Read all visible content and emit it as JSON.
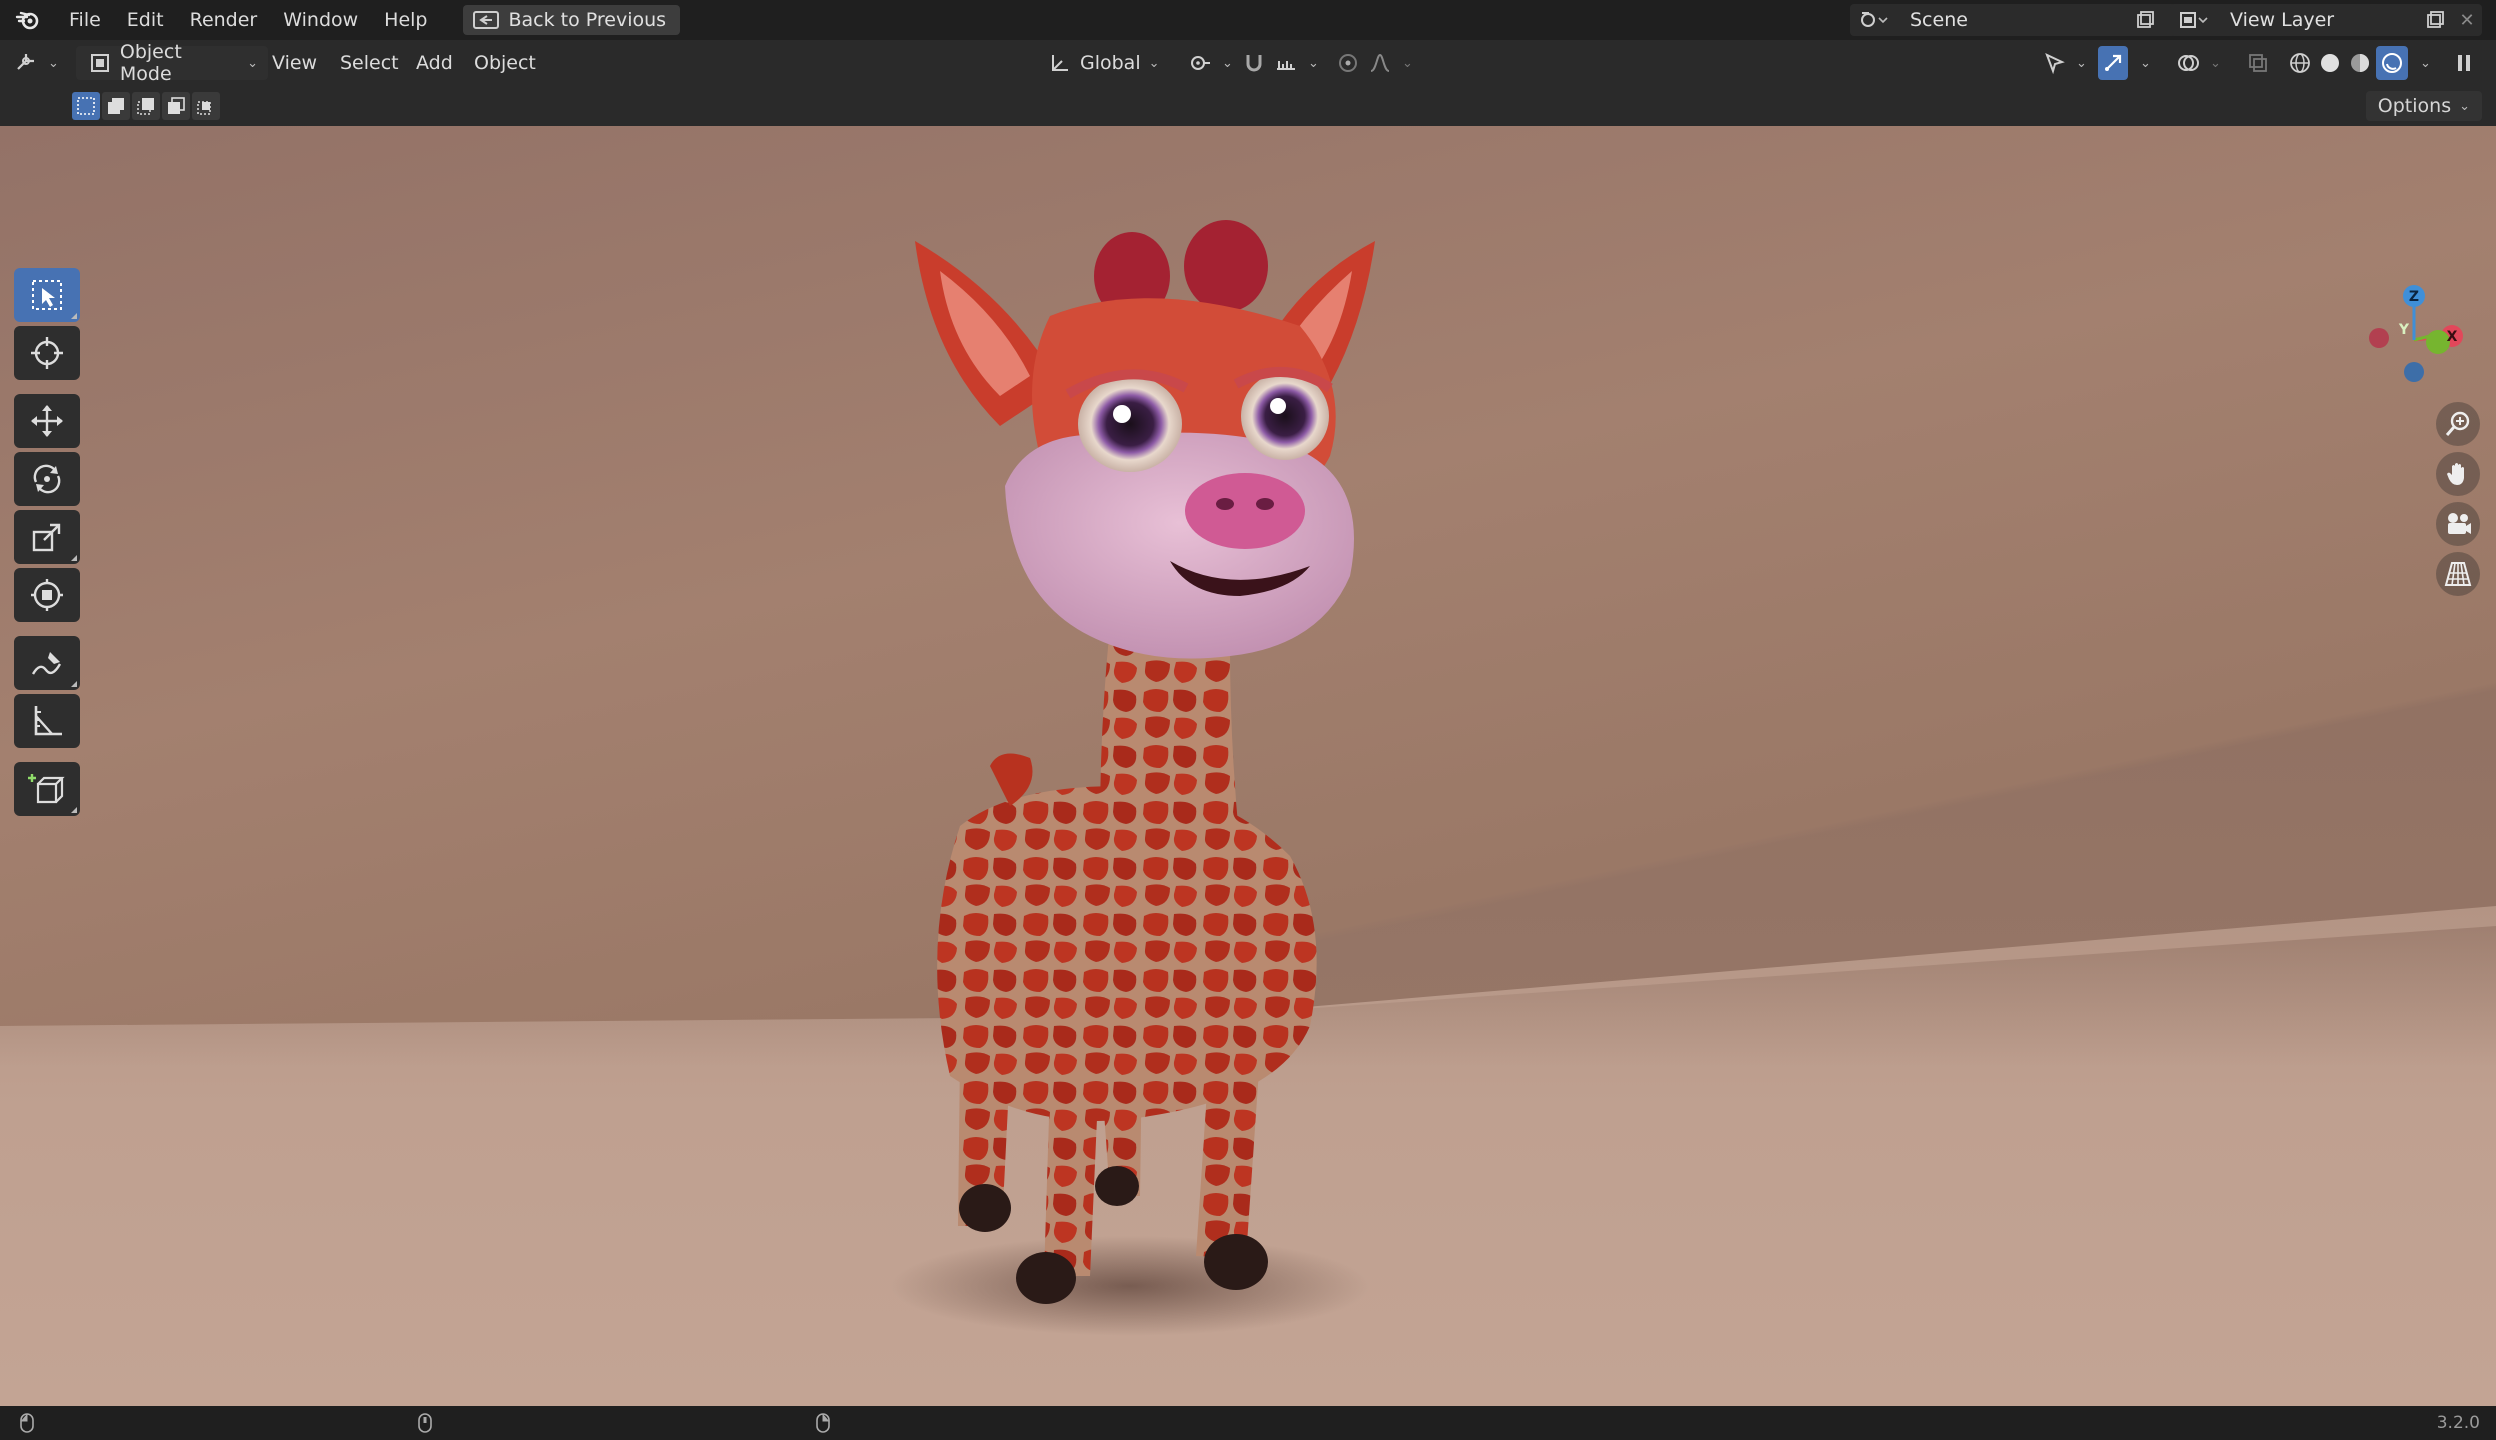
{
  "app": {
    "name": "Blender",
    "version": "3.2.0"
  },
  "menu": {
    "items": [
      "File",
      "Edit",
      "Render",
      "Window",
      "Help"
    ],
    "back_button": "Back to Previous"
  },
  "scene": {
    "label": "Scene"
  },
  "view_layer": {
    "label": "View Layer"
  },
  "header": {
    "mode": "Object Mode",
    "menus": [
      "View",
      "Select",
      "Add",
      "Object"
    ],
    "transform_orientation": "Global"
  },
  "tool_settings": {
    "options_label": "Options"
  },
  "tools": [
    "select-box",
    "cursor",
    "move",
    "rotate",
    "scale",
    "transform",
    "annotate",
    "measure",
    "add-cube"
  ],
  "gizmo": {
    "x": "X",
    "y": "Y",
    "z": "Z"
  },
  "colors": {
    "accent": "#4772b3",
    "axis_x": "#e2475a",
    "axis_y": "#76b52f",
    "axis_z": "#3f8fd8",
    "giraffe_fur": "#c6402e",
    "giraffe_muzzle": "#d8a8c4"
  }
}
